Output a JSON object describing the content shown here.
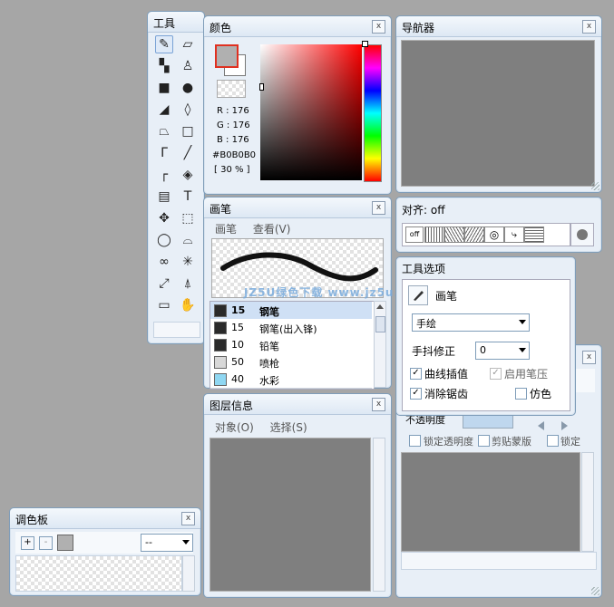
{
  "tools_panel": {
    "title": "工具",
    "icons": [
      "pen-icon",
      "eraser-icon",
      "dot-pattern-icon",
      "stamp-icon",
      "square-fill-icon",
      "circle-fill-icon",
      "quad-fill-icon",
      "pattern-icon",
      "trapezoid-icon",
      "rect-outline-icon",
      "curve-pen-icon",
      "line-icon",
      "corner-icon",
      "fill-bucket-icon",
      "gradient-icon",
      "text-icon",
      "move-icon",
      "rect-select-icon",
      "ellipse-select-icon",
      "lasso-icon",
      "freehand-select-icon",
      "magic-wand-icon",
      "transform-icon",
      "eyedropper-icon",
      "ruler-icon",
      "hand-icon",
      "rotate-hand-icon"
    ]
  },
  "color_panel": {
    "title": "颜色",
    "r_label": "R : 176",
    "g_label": "G : 176",
    "b_label": "B : 176",
    "hex": "#B0B0B0",
    "opacity": "[ 30 % ]",
    "fg_color": "#b0b0b0"
  },
  "navigator_panel": {
    "title": "导航器"
  },
  "brush_panel": {
    "title": "画笔",
    "menu": [
      "画笔",
      "查看(V)"
    ],
    "brushes": [
      {
        "size": "15",
        "name": "钢笔",
        "color": "#2a2a2a"
      },
      {
        "size": "15",
        "name": "钢笔(出入锋)",
        "color": "#2a2a2a"
      },
      {
        "size": "10",
        "name": "铅笔",
        "color": "#2a2a2a"
      },
      {
        "size": "50",
        "name": "喷枪",
        "color": "#d8d8d8"
      },
      {
        "size": "40",
        "name": "水彩",
        "color": "#8fd7f2"
      }
    ],
    "watermark": "JZ5U绿色下载 www.jz5u.com"
  },
  "align_panel": {
    "title": "对齐: off",
    "off_label": "off"
  },
  "tool_options_panel": {
    "title": "工具选项",
    "tool_name": "画笔",
    "mode": "手绘",
    "stabilizer_label": "手抖修正",
    "stabilizer_value": "0",
    "checks": {
      "curve": "曲线插值",
      "pressure": "启用笔压",
      "antialias": "消除锯齿",
      "pseudo": "仿色"
    }
  },
  "layer_info_panel": {
    "title": "图层信息",
    "menu": [
      "对象(O)",
      "选择(S)"
    ]
  },
  "layer_panel": {
    "opacity_label": "不透明度",
    "lock_label": "锁定透明度",
    "clip_label": "剪贴蒙版",
    "lock2_label": "锁定"
  },
  "palette_panel": {
    "title": "调色板",
    "add": "+",
    "remove": "-",
    "select": "--"
  }
}
